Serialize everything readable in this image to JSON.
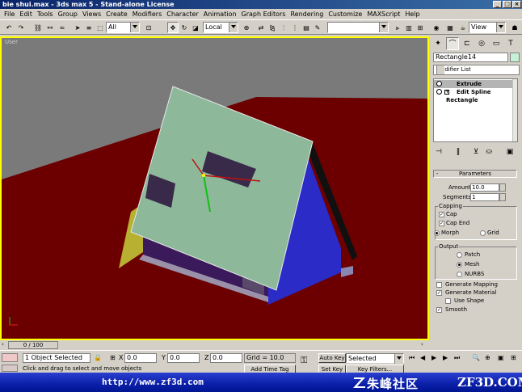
{
  "window": {
    "title": "bie shui.max - 3ds max 5 - Stand-alone License"
  },
  "menu": [
    "File",
    "Edit",
    "Tools",
    "Group",
    "Views",
    "Create",
    "Modifiers",
    "Character",
    "Animation",
    "Graph Editors",
    "Rendering",
    "Customize",
    "MAXScript",
    "Help"
  ],
  "toolbar": {
    "selection_filter": "All",
    "coord_system": "Local",
    "named_selection": "",
    "viewport_render": "View"
  },
  "viewport": {
    "label": "User",
    "colors": {
      "background": "#6c0000",
      "ground": "#7a7a7a",
      "roof": "#8db89a",
      "wall": "#2b2bc8",
      "border": "#ffff00"
    }
  },
  "command_panel": {
    "object_name": "Rectangle14",
    "modifier_list": "Modifier List",
    "stack": [
      {
        "label": "Extrude",
        "selected": true
      },
      {
        "label": "Edit Spline",
        "selected": false
      },
      {
        "label": "Rectangle",
        "selected": false
      }
    ],
    "parameters": {
      "title": "Parameters",
      "amount_label": "Amount:",
      "amount": "10.0",
      "segments_label": "Segments:",
      "segments": "1",
      "capping": {
        "title": "Capping",
        "cap_start": "Cap",
        "cap_end": "Cap End",
        "morph": "Morph",
        "grid": "Grid"
      },
      "output": {
        "title": "Output",
        "patch": "Patch",
        "mesh": "Mesh",
        "nurbs": "NURBS"
      },
      "generate_mapping": "Generate Mapping",
      "generate_material": "Generate Material",
      "use_shape": "Use Shape",
      "smooth": "Smooth"
    }
  },
  "timeline": {
    "frame": "0 / 100"
  },
  "status": {
    "selection": "1 Object Selected",
    "x_label": "X",
    "x": "0.0",
    "y_label": "Y",
    "y": "0.0",
    "z_label": "Z",
    "z": "0.0",
    "grid": "Grid = 10.0",
    "auto_key": "Auto Key",
    "set_key": "Set Key",
    "key_set": "Selected",
    "key_filters": "Key Filters...",
    "add_time_tag": "Add Time Tag",
    "prompt": "Click and drag to select and move objects"
  },
  "watermark": {
    "url": "http://www.zf3d.com",
    "cn": "朱峰社区",
    "site": "ZF3D.COM"
  }
}
